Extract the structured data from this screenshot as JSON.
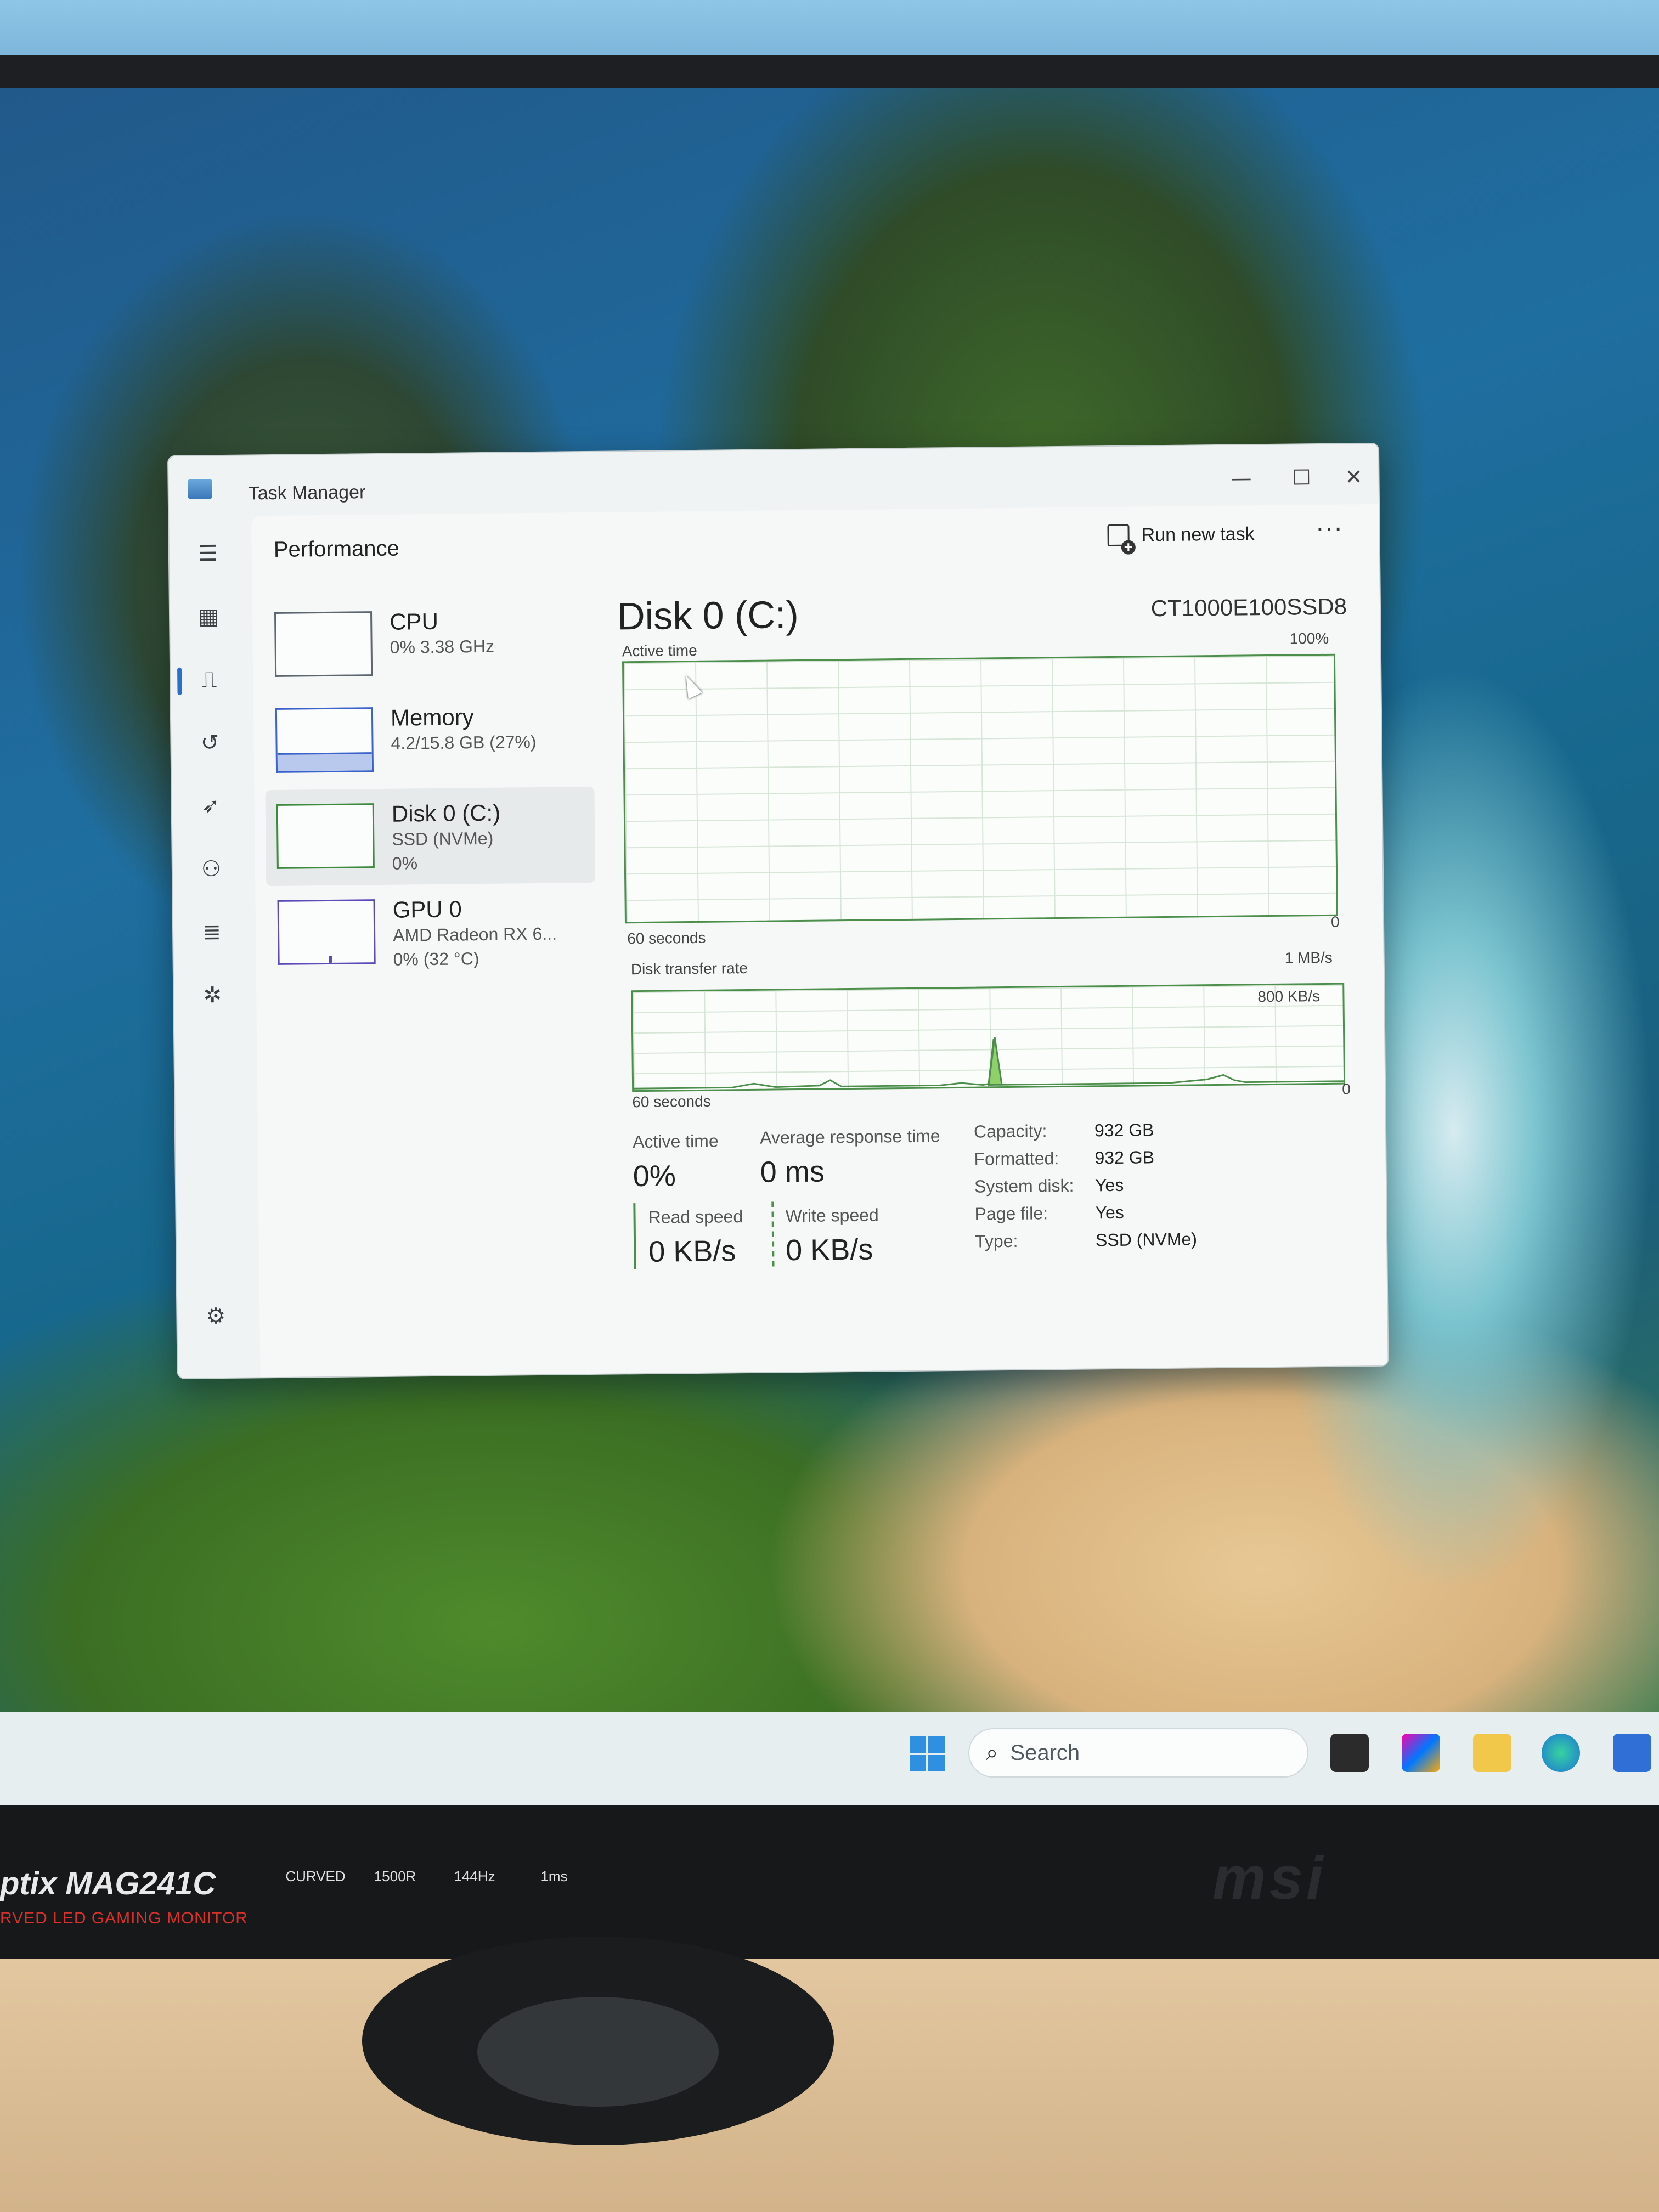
{
  "window": {
    "title": "Task Manager",
    "minimize": "—",
    "maximize": "☐",
    "close": "✕"
  },
  "header": {
    "page_title": "Performance",
    "run_new_task": "Run new task",
    "more": "···"
  },
  "sidebar": {
    "items": [
      {
        "name": "CPU",
        "sub": "0% 3.38 GHz",
        "sub2": ""
      },
      {
        "name": "Memory",
        "sub": "4.2/15.8 GB (27%)",
        "sub2": ""
      },
      {
        "name": "Disk 0 (C:)",
        "sub": "SSD (NVMe)",
        "sub2": "0%"
      },
      {
        "name": "GPU 0",
        "sub": "AMD Radeon RX 6...",
        "sub2": "0% (32 °C)"
      }
    ],
    "memory_percent": 27,
    "selected": "Disk 0 (C:)"
  },
  "detail": {
    "title": "Disk 0 (C:)",
    "model": "CT1000E100SSD8",
    "active_time_graph": {
      "label": "Active time",
      "max": "100%",
      "min": "0",
      "duration": "60 seconds"
    },
    "transfer_graph": {
      "label": "Disk transfer rate",
      "max": "1 MB/s",
      "mid": "800 KB/s",
      "min": "0",
      "duration": "60 seconds"
    },
    "stats": {
      "active_time_label": "Active time",
      "active_time_value": "0%",
      "avg_response_label": "Average response time",
      "avg_response_value": "0 ms",
      "read_label": "Read speed",
      "read_value": "0 KB/s",
      "write_label": "Write speed",
      "write_value": "0 KB/s"
    },
    "properties": [
      {
        "key": "Capacity:",
        "value": "932 GB"
      },
      {
        "key": "Formatted:",
        "value": "932 GB"
      },
      {
        "key": "System disk:",
        "value": "Yes"
      },
      {
        "key": "Page file:",
        "value": "Yes"
      },
      {
        "key": "Type:",
        "value": "SSD (NVMe)"
      }
    ]
  },
  "taskbar": {
    "search_label": "Search"
  },
  "monitor": {
    "model_text": "ptix MAG241C",
    "tagline": "RVED LED GAMING MONITOR",
    "brand": "msi",
    "badges": [
      "CURVED",
      "1500R",
      "144Hz",
      "1ms"
    ]
  },
  "colors": {
    "disk_accent": "#4b8f4b",
    "memory_accent": "#3c63c9",
    "gpu_accent": "#5f4bb8",
    "rail_active": "#2c6ecb"
  }
}
